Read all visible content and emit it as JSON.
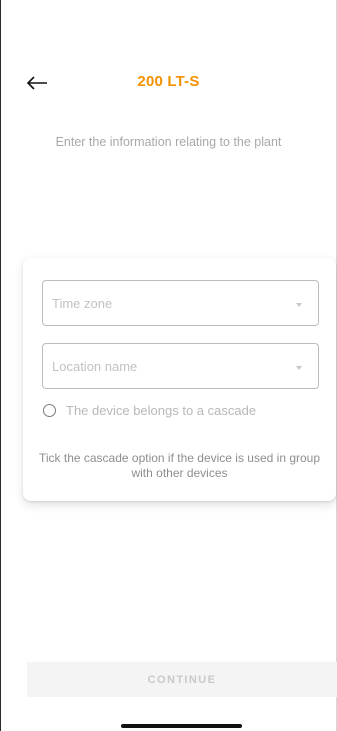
{
  "header": {
    "back_icon": "arrow-left-icon",
    "title": "200 LT-S"
  },
  "subtitle": "Enter the information relating to the plant",
  "form": {
    "time_zone": {
      "placeholder": "Time zone",
      "icon": "chevron-down-icon"
    },
    "location_name": {
      "placeholder": "Location name",
      "icon": "chevron-down-icon"
    },
    "cascade": {
      "label": "The device belongs to a cascade",
      "checked": false,
      "icon": "radio-unchecked-icon"
    },
    "hint": "Tick the cascade option if the device is used in group with other devices"
  },
  "footer": {
    "continue_label": "CONTINUE"
  },
  "colors": {
    "accent": "#F39200",
    "placeholder": "#C2C2C2",
    "hint": "#8E8E8E",
    "disabled_button_bg": "#F4F4F4",
    "disabled_button_text": "#C9C9C9"
  }
}
